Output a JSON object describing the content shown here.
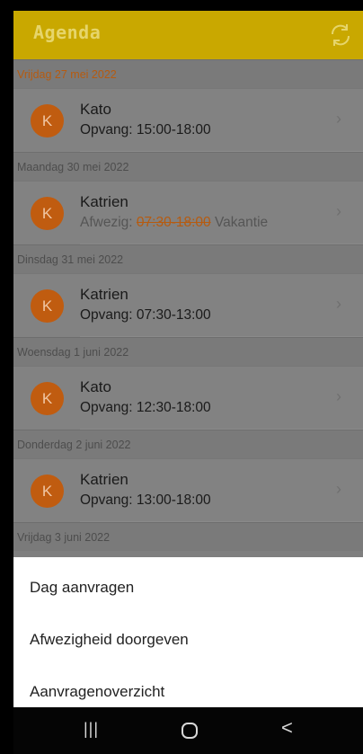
{
  "header": {
    "title": "Agenda",
    "refresh_icon": "refresh-icon"
  },
  "agenda": [
    {
      "date": "Vrijdag 27 mei 2022",
      "entries": [
        {
          "initial": "K",
          "name": "Kato",
          "type": "Opvang:",
          "time": "15:00-18:00",
          "absent": false
        }
      ]
    },
    {
      "date": "Maandag 30 mei 2022",
      "entries": [
        {
          "initial": "K",
          "name": "Katrien",
          "type": "Afwezig:",
          "time": "07:30-18:00",
          "reason": "Vakantie",
          "absent": true
        }
      ]
    },
    {
      "date": "Dinsdag 31 mei 2022",
      "entries": [
        {
          "initial": "K",
          "name": "Katrien",
          "type": "Opvang:",
          "time": "07:30-13:00",
          "absent": false
        }
      ]
    },
    {
      "date": "Woensdag 1 juni 2022",
      "entries": [
        {
          "initial": "K",
          "name": "Kato",
          "type": "Opvang:",
          "time": "12:30-18:00",
          "absent": false
        }
      ]
    },
    {
      "date": "Donderdag 2 juni 2022",
      "entries": [
        {
          "initial": "K",
          "name": "Katrien",
          "type": "Opvang:",
          "time": "13:00-18:00",
          "absent": false
        }
      ]
    },
    {
      "date": "Vrijdag 3 juni 2022",
      "entries": []
    }
  ],
  "sheet": {
    "items": [
      "Dag aanvragen",
      "Afwezigheid doorgeven",
      "Aanvragenoverzicht"
    ]
  },
  "navbar": {
    "recent": "|||",
    "back": "<"
  },
  "colors": {
    "accent": "#c9a800",
    "avatar": "#c05c10",
    "date_highlight": "#b65b10"
  }
}
